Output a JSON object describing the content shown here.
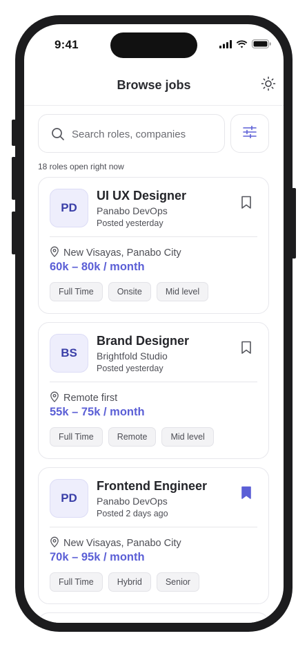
{
  "status_bar": {
    "time": "9:41"
  },
  "header": {
    "title": "Browse jobs",
    "theme_icon": "sun-icon"
  },
  "search": {
    "placeholder": "Search roles, companies",
    "value": "",
    "filter_icon": "sliders-icon"
  },
  "roles_count": "18 roles open right now",
  "colors": {
    "accent": "#5b5fd6",
    "logo_bg": "#eeeefc",
    "tag_bg": "#f3f3f5"
  },
  "jobs": [
    {
      "logo": "PD",
      "title": "UI UX Designer",
      "company": "Panabo DevOps",
      "posted": "Posted yesterday",
      "location": "New Visayas, Panabo City",
      "salary": "60k – 80k / month",
      "bookmarked": false,
      "tags": [
        "Full Time",
        "Onsite",
        "Mid level"
      ]
    },
    {
      "logo": "BS",
      "title": "Brand Designer",
      "company": "Brightfold Studio",
      "posted": "Posted yesterday",
      "location": "Remote first",
      "salary": "55k – 75k / month",
      "bookmarked": false,
      "tags": [
        "Full Time",
        "Remote",
        "Mid level"
      ]
    },
    {
      "logo": "PD",
      "title": "Frontend Engineer",
      "company": "Panabo DevOps",
      "posted": "Posted 2 days ago",
      "location": "New Visayas, Panabo City",
      "salary": "70k – 95k / month",
      "bookmarked": true,
      "tags": [
        "Full Time",
        "Hybrid",
        "Senior"
      ]
    }
  ]
}
